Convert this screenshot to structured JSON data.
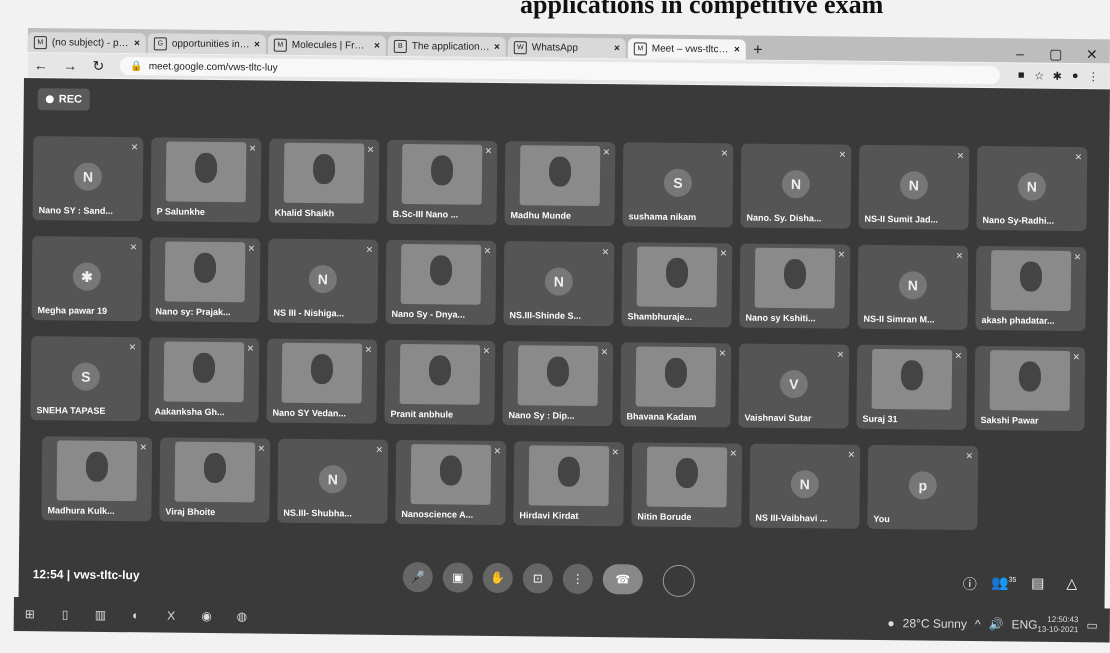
{
  "page_heading": "applications in competitive exam",
  "browser": {
    "tabs": [
      {
        "icon": "M",
        "label": "(no subject) - prajakta"
      },
      {
        "icon": "G",
        "label": "opportunities in nano"
      },
      {
        "icon": "M",
        "label": "Molecules | Free Full-T"
      },
      {
        "icon": "B",
        "label": "The application nanot"
      },
      {
        "icon": "W",
        "label": "WhatsApp"
      },
      {
        "icon": "M",
        "label": "Meet – vws-tltc-luy"
      }
    ],
    "url": "meet.google.com/vws-tltc-luy"
  },
  "meet": {
    "rec_label": "REC",
    "time": "12:54",
    "meeting_code": "vws-tltc-luy",
    "participants": [
      [
        {
          "name": "Nano SY : Sand...",
          "initial": "N",
          "video": false
        },
        {
          "name": "P Salunkhe",
          "initial": "",
          "video": true
        },
        {
          "name": "Khalid Shaikh",
          "initial": "",
          "video": true
        },
        {
          "name": "B.Sc-III Nano ...",
          "initial": "",
          "video": true
        },
        {
          "name": "Madhu Munde",
          "initial": "",
          "video": true
        },
        {
          "name": "sushama nikam",
          "initial": "S",
          "video": false
        },
        {
          "name": "Nano. Sy. Disha...",
          "initial": "N",
          "video": false
        },
        {
          "name": "NS-II Sumit Jad...",
          "initial": "N",
          "video": false
        },
        {
          "name": "Nano Sy-Radhi...",
          "initial": "N",
          "video": false
        }
      ],
      [
        {
          "name": "Megha pawar 19",
          "initial": "✱",
          "video": false
        },
        {
          "name": "Nano sy: Prajak...",
          "initial": "",
          "video": true
        },
        {
          "name": "NS III - Nishiga...",
          "initial": "N",
          "video": false
        },
        {
          "name": "Nano Sy - Dnya...",
          "initial": "",
          "video": true
        },
        {
          "name": "NS.III-Shinde S...",
          "initial": "N",
          "video": false
        },
        {
          "name": "Shambhuraje...",
          "initial": "",
          "video": true
        },
        {
          "name": "Nano sy Kshiti...",
          "initial": "",
          "video": true
        },
        {
          "name": "NS-II Simran M...",
          "initial": "N",
          "video": false
        },
        {
          "name": "akash phadatar...",
          "initial": "",
          "video": true
        }
      ],
      [
        {
          "name": "SNEHA TAPASE",
          "initial": "S",
          "video": false
        },
        {
          "name": "Aakanksha Gh...",
          "initial": "",
          "video": true
        },
        {
          "name": "Nano SY Vedan...",
          "initial": "",
          "video": true
        },
        {
          "name": "Pranit anbhule",
          "initial": "",
          "video": true
        },
        {
          "name": "Nano Sy : Dip...",
          "initial": "",
          "video": true
        },
        {
          "name": "Bhavana Kadam",
          "initial": "",
          "video": true
        },
        {
          "name": "Vaishnavi Sutar",
          "initial": "V",
          "video": false
        },
        {
          "name": "Suraj 31",
          "initial": "",
          "video": true
        },
        {
          "name": "Sakshi Pawar",
          "initial": "",
          "video": true
        }
      ],
      [
        {
          "name": "Madhura Kulk...",
          "initial": "",
          "video": true
        },
        {
          "name": "Viraj Bhoite",
          "initial": "",
          "video": true
        },
        {
          "name": "NS.III- Shubha...",
          "initial": "N",
          "video": false
        },
        {
          "name": "Nanoscience A...",
          "initial": "",
          "video": true
        },
        {
          "name": "Hirdavi Kirdat",
          "initial": "",
          "video": true
        },
        {
          "name": "Nitin Borude",
          "initial": "",
          "video": true
        },
        {
          "name": "NS III-Vaibhavi ...",
          "initial": "N",
          "video": false
        },
        {
          "name": "You",
          "initial": "p",
          "video": false
        }
      ]
    ],
    "control_icons": [
      "mic-off",
      "camera-off",
      "raise-hand",
      "present",
      "more",
      "leave-call"
    ],
    "side_icons": [
      "info",
      "people",
      "chat",
      "activities"
    ],
    "people_count": "35"
  },
  "taskbar": {
    "weather": "28°C  Sunny",
    "lang": "ENG",
    "time": "12:50:43",
    "date": "13-10-2021"
  }
}
